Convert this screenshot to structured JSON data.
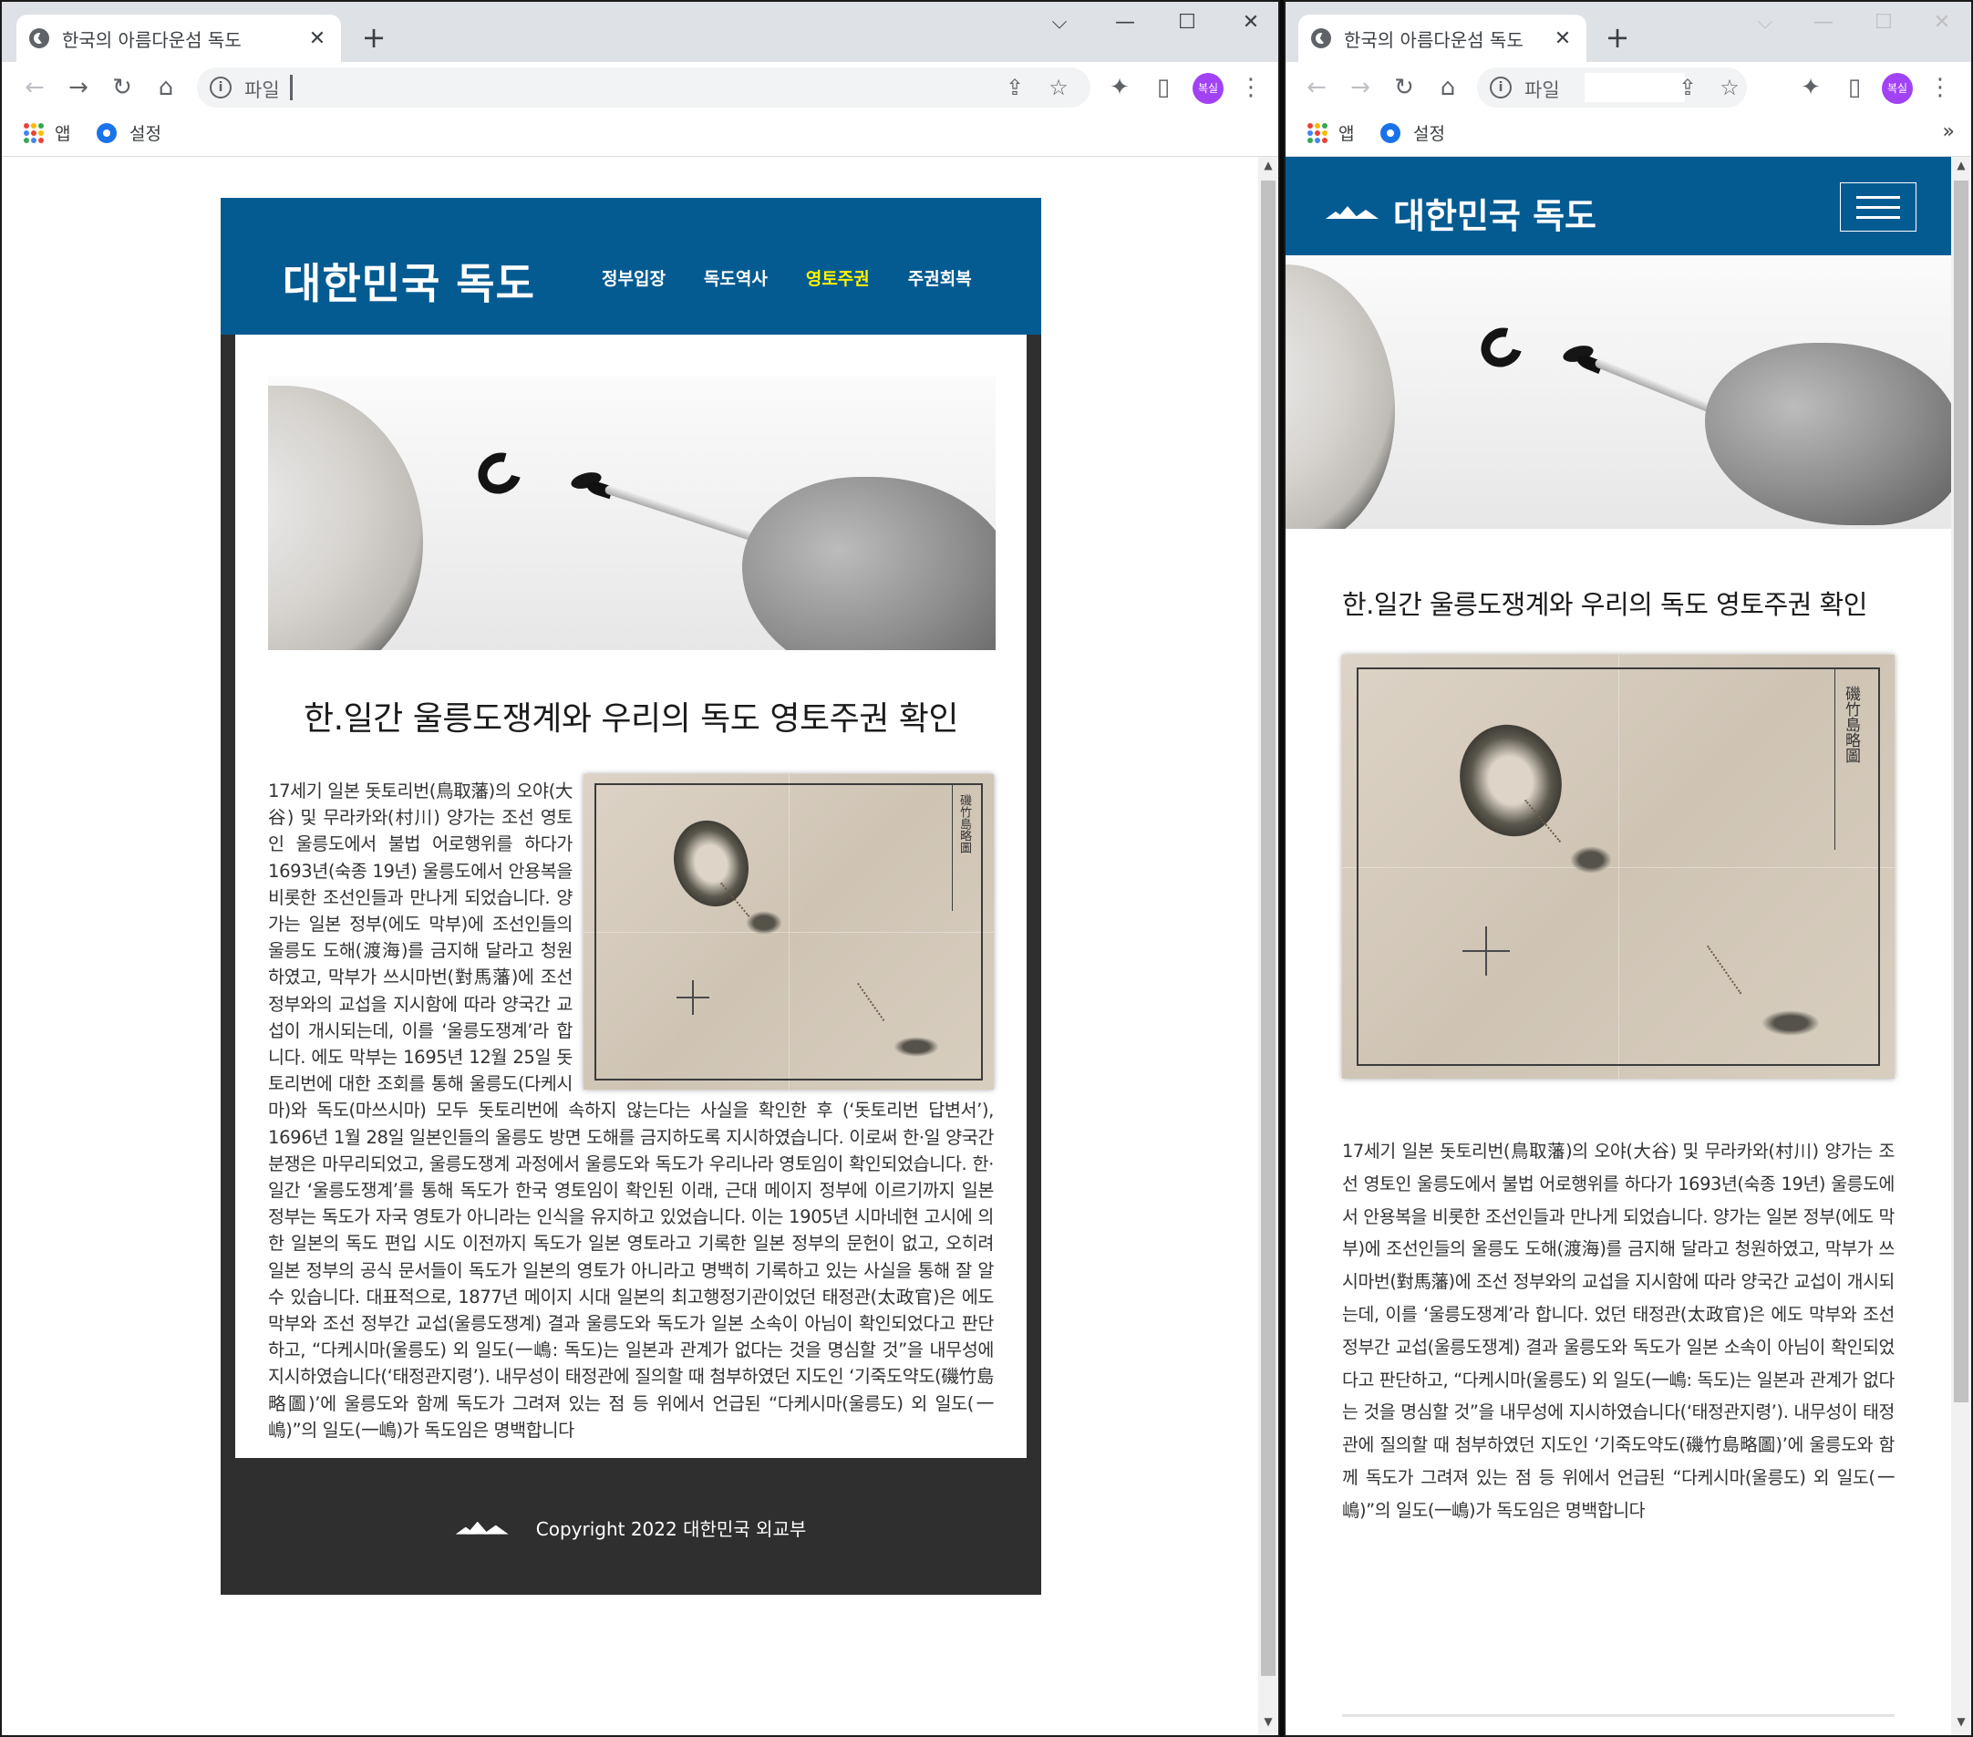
{
  "browser": {
    "tab_title": "한국의 아름다운섬 독도",
    "tab_close": "✕",
    "new_tab": "+",
    "window_controls": {
      "dropdown": "⌵",
      "minimize": "—",
      "maximize": "☐",
      "close": "✕"
    },
    "nav": {
      "back": "←",
      "forward": "→",
      "reload": "↻",
      "home": "⌂"
    },
    "address": {
      "info": "i",
      "scheme": "파일",
      "value": ""
    },
    "actions": {
      "share": "⇪",
      "bookmark": "☆",
      "extensions": "✦",
      "side_panel": "▯",
      "menu": "⋮"
    },
    "profile": "복실",
    "bookmarks": [
      {
        "label": "앱",
        "icon": "apps-grid-icon"
      },
      {
        "label": "설정",
        "icon": "settings-gear-icon"
      }
    ],
    "bookmarks_more": "»",
    "apps_grid_colors": [
      "#ea4335",
      "#fbbc04",
      "#34a853",
      "#4285f4",
      "#ea4335",
      "#fbbc04",
      "#34a853",
      "#4285f4",
      "#ea4335"
    ]
  },
  "site": {
    "title": "대한민국 독도",
    "nav": [
      "정부입장",
      "독도역사",
      "영토주권",
      "주권회복"
    ],
    "active_nav": "영토주권",
    "heading": "한.일간 울릉도쟁계와 우리의 독도 영토주권 확인",
    "map_title": "磯竹島略圖",
    "body": "17세기 일본 돗토리번(鳥取藩)의 오야(大谷) 및 무라카와(村川) 양가는 조선 영토인 울릉도에서 불법 어로행위를 하다가 1693년(숙종 19년) 울릉도에서 안용복을 비롯한 조선인들과 만나게 되었습니다. 양가는 일본 정부(에도 막부)에 조선인들의 울릉도 도해(渡海)를 금지해 달라고 청원하였고, 막부가 쓰시마번(對馬藩)에 조선 정부와의 교섭을 지시함에 따라 양국간 교섭이 개시되는데, 이를 ‘울릉도쟁계’라 합니다. 에도 막부는 1695년 12월 25일 돗토리번에 대한 조회를 통해 울릉도(다케시마)와 독도(마쓰시마) 모두 돗토리번에 속하지 않는다는 사실을 확인한 후 (‘돗토리번 답변서’), 1696년 1월 28일 일본인들의 울릉도 방면 도해를 금지하도록 지시하였습니다. 이로써 한·일 양국간 분쟁은 마무리되었고, 울릉도쟁계 과정에서 울릉도와 독도가 우리나라 영토임이 확인되었습니다. 한·일간 ‘울릉도쟁계’를 통해 독도가 한국 영토임이 확인된 이래, 근대 메이지 정부에 이르기까지 일본 정부는 독도가 자국 영토가 아니라는 인식을 유지하고 있었습니다. 이는 1905년 시마네현 고시에 의한 일본의 독도 편입 시도 이전까지 독도가 일본 영토라고 기록한 일본 정부의 문헌이 없고, 오히려 일본 정부의 공식 문서들이 독도가 일본의 영토가 아니라고 명백히 기록하고 있는 사실을 통해 잘 알 수 있습니다. 대표적으로, 1877년 메이지 시대 일본의 최고행정기관이었던 태정관(太政官)은 에도 막부와 조선 정부간 교섭(울릉도쟁계) 결과 울릉도와 독도가 일본 소속이 아님이 확인되었다고 판단하고, “다케시마(울릉도) 외 일도(一嶋: 독도)는 일본과 관계가 없다는 것을 명심할 것”을 내무성에 지시하였습니다(‘태정관지령’). 내무성이 태정관에 질의할 때 첨부하였던 지도인 ‘기죽도약도(磯竹島略圖)’에 울릉도와 함께 독도가 그려져 있는 점 등 위에서 언급된 “다케시마(울릉도) 외 일도(一嶋)”의 일도(一嶋)가 독도임은 명백합니다",
    "body_mobile": "17세기 일본 돗토리번(鳥取藩)의 오야(大谷) 및 무라카와(村川) 양가는 조선 영토인 울릉도에서 불법 어로행위를 하다가 1693년(숙종 19년) 울릉도에서 안용복을 비롯한 조선인들과 만나게 되었습니다. 양가는 일본 정부(에도 막부)에 조선인들의 울릉도 도해(渡海)를 금지해 달라고 청원하였고, 막부가 쓰시마번(對馬藩)에 조선 정부와의 교섭을 지시함에 따라 양국간 교섭이 개시되는데, 이를 ‘울릉도쟁계’라 합니다. 었던 태정관(太政官)은 에도 막부와 조선 정부간 교섭(울릉도쟁계) 결과 울릉도와 독도가 일본 소속이 아님이 확인되었다고 판단하고, “다케시마(울릉도) 외 일도(一嶋: 독도)는 일본과 관계가 없다는 것을 명심할 것”을 내무성에 지시하였습니다(‘태정관지령’). 내무성이 태정관에 질의할 때 첨부하였던 지도인 ‘기죽도약도(磯竹島略圖)’에 울릉도와 함께 독도가 그려져 있는 점 등 위에서 언급된 “다케시마(울릉도) 외 일도(一嶋)”의 일도(一嶋)가 독도임은 명백합니다",
    "copyright": "Copyright 2022 대한민국 외교부"
  },
  "colors": {
    "header": "#045b92",
    "nav_active": "#fff200",
    "footer": "#2f2f2f"
  }
}
